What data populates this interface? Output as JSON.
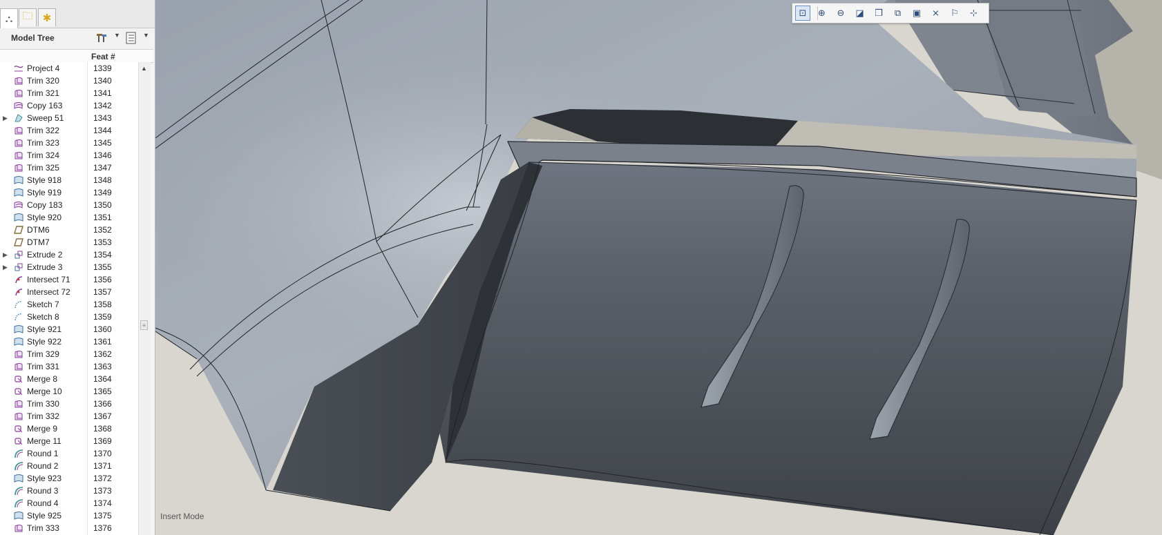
{
  "nav_tabs": [
    {
      "icon": "model-tree-icon",
      "glyph": "⛬"
    },
    {
      "icon": "folder-browser-icon",
      "glyph": "🗀"
    },
    {
      "icon": "favorites-icon",
      "glyph": "✱"
    }
  ],
  "tree": {
    "title": "Model Tree",
    "settings_icon": "tree-settings-icon",
    "columns_icon": "tree-columns-icon",
    "column_feat": "Feat #",
    "rows": [
      {
        "label": "Project 4",
        "feat": "1339",
        "icon": "project-icon",
        "expandable": false
      },
      {
        "label": "Trim 320",
        "feat": "1340",
        "icon": "trim-icon",
        "expandable": false
      },
      {
        "label": "Trim 321",
        "feat": "1341",
        "icon": "trim-icon",
        "expandable": false
      },
      {
        "label": "Copy 163",
        "feat": "1342",
        "icon": "copy-icon",
        "expandable": false
      },
      {
        "label": "Sweep 51",
        "feat": "1343",
        "icon": "sweep-icon",
        "expandable": true
      },
      {
        "label": "Trim 322",
        "feat": "1344",
        "icon": "trim-icon",
        "expandable": false
      },
      {
        "label": "Trim 323",
        "feat": "1345",
        "icon": "trim-icon",
        "expandable": false
      },
      {
        "label": "Trim 324",
        "feat": "1346",
        "icon": "trim-icon",
        "expandable": false
      },
      {
        "label": "Trim 325",
        "feat": "1347",
        "icon": "trim-icon",
        "expandable": false
      },
      {
        "label": "Style 918",
        "feat": "1348",
        "icon": "style-icon",
        "expandable": false
      },
      {
        "label": "Style 919",
        "feat": "1349",
        "icon": "style-icon",
        "expandable": false
      },
      {
        "label": "Copy 183",
        "feat": "1350",
        "icon": "copy-icon",
        "expandable": false
      },
      {
        "label": "Style 920",
        "feat": "1351",
        "icon": "style-icon",
        "expandable": false
      },
      {
        "label": "DTM6",
        "feat": "1352",
        "icon": "datum-plane-icon",
        "expandable": false
      },
      {
        "label": "DTM7",
        "feat": "1353",
        "icon": "datum-plane-icon",
        "expandable": false
      },
      {
        "label": "Extrude 2",
        "feat": "1354",
        "icon": "extrude-icon",
        "expandable": true
      },
      {
        "label": "Extrude 3",
        "feat": "1355",
        "icon": "extrude-icon",
        "expandable": true
      },
      {
        "label": "Intersect 71",
        "feat": "1356",
        "icon": "intersect-icon",
        "expandable": false
      },
      {
        "label": "Intersect 72",
        "feat": "1357",
        "icon": "intersect-icon",
        "expandable": false
      },
      {
        "label": "Sketch 7",
        "feat": "1358",
        "icon": "sketch-icon",
        "expandable": false
      },
      {
        "label": "Sketch 8",
        "feat": "1359",
        "icon": "sketch-icon",
        "expandable": false
      },
      {
        "label": "Style 921",
        "feat": "1360",
        "icon": "style-icon",
        "expandable": false
      },
      {
        "label": "Style 922",
        "feat": "1361",
        "icon": "style-icon",
        "expandable": false
      },
      {
        "label": "Trim 329",
        "feat": "1362",
        "icon": "trim-icon",
        "expandable": false
      },
      {
        "label": "Trim 331",
        "feat": "1363",
        "icon": "trim-icon",
        "expandable": false
      },
      {
        "label": "Merge 8",
        "feat": "1364",
        "icon": "merge-icon",
        "expandable": false
      },
      {
        "label": "Merge 10",
        "feat": "1365",
        "icon": "merge-icon",
        "expandable": false
      },
      {
        "label": "Trim 330",
        "feat": "1366",
        "icon": "trim-icon",
        "expandable": false
      },
      {
        "label": "Trim 332",
        "feat": "1367",
        "icon": "trim-icon",
        "expandable": false
      },
      {
        "label": "Merge 9",
        "feat": "1368",
        "icon": "merge-icon",
        "expandable": false
      },
      {
        "label": "Merge 11",
        "feat": "1369",
        "icon": "merge-icon",
        "expandable": false
      },
      {
        "label": "Round 1",
        "feat": "1370",
        "icon": "round-icon",
        "expandable": false
      },
      {
        "label": "Round 2",
        "feat": "1371",
        "icon": "round-icon",
        "expandable": false
      },
      {
        "label": "Style 923",
        "feat": "1372",
        "icon": "style-icon",
        "expandable": false
      },
      {
        "label": "Round 3",
        "feat": "1373",
        "icon": "round-icon",
        "expandable": false
      },
      {
        "label": "Round 4",
        "feat": "1374",
        "icon": "round-icon",
        "expandable": false
      },
      {
        "label": "Style 925",
        "feat": "1375",
        "icon": "style-icon",
        "expandable": false
      },
      {
        "label": "Trim 333",
        "feat": "1376",
        "icon": "trim-icon",
        "expandable": false
      }
    ]
  },
  "view_toolbar": [
    {
      "icon": "refit-icon",
      "glyph": "⊡",
      "selected": true
    },
    {
      "icon": "zoom-in-icon",
      "glyph": "⊕",
      "selected": false
    },
    {
      "icon": "zoom-out-icon",
      "glyph": "⊖",
      "selected": false
    },
    {
      "icon": "repaint-icon",
      "glyph": "◪",
      "selected": false
    },
    {
      "icon": "display-style-icon",
      "glyph": "❒",
      "selected": false
    },
    {
      "icon": "saved-orientations-icon",
      "glyph": "⧉",
      "selected": false
    },
    {
      "icon": "view-manager-icon",
      "glyph": "▣",
      "selected": false
    },
    {
      "icon": "datum-display-filters-icon",
      "glyph": "⨯",
      "selected": false
    },
    {
      "icon": "annotation-display-icon",
      "glyph": "⚐",
      "selected": false
    },
    {
      "icon": "spin-center-icon",
      "glyph": "⊹",
      "selected": false
    }
  ],
  "status": {
    "mode_text": "Insert Mode"
  },
  "colors": {
    "viewport_bg": "#d9d7cf",
    "surface_light": "#a2a9b2",
    "surface_dark": "#3f444b",
    "icon_purple": "#8a3d9a"
  }
}
